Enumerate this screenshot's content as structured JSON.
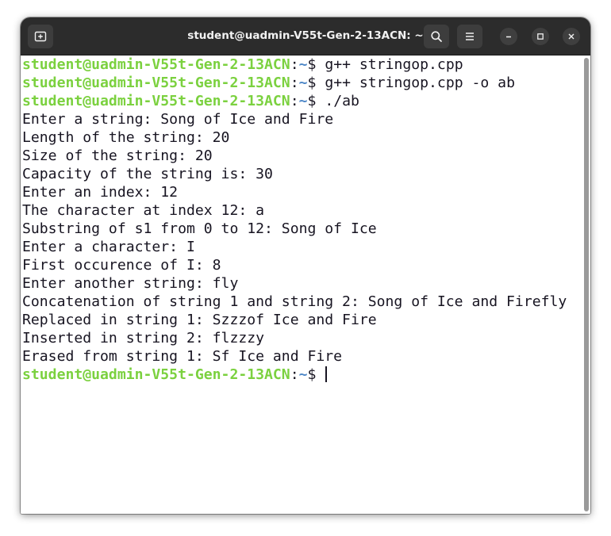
{
  "window": {
    "title": "student@uadmin-V55t-Gen-2-13ACN: ~",
    "new_tab_icon": "new-tab-icon",
    "search_icon": "search-icon",
    "menu_icon": "hamburger-menu-icon",
    "minimize_icon": "minimize-icon",
    "maximize_icon": "maximize-icon",
    "close_icon": "close-icon"
  },
  "colors": {
    "prompt_user": "#7bd13f",
    "prompt_path": "#4f88c8",
    "text": "#171421",
    "titlebar": "#2c2c2c"
  },
  "prompt": {
    "user_host": "student@uadmin-V55t-Gen-2-13ACN",
    "sep": ":",
    "path": "~",
    "symbol": "$ "
  },
  "terminal": {
    "lines": [
      {
        "type": "cmd",
        "text": "g++ stringop.cpp"
      },
      {
        "type": "cmd",
        "text": "g++ stringop.cpp -o ab"
      },
      {
        "type": "cmd",
        "text": "./ab"
      },
      {
        "type": "out",
        "text": "Enter a string: Song of Ice and Fire"
      },
      {
        "type": "out",
        "text": "Length of the string: 20"
      },
      {
        "type": "out",
        "text": "Size of the string: 20"
      },
      {
        "type": "out",
        "text": "Capacity of the string is: 30"
      },
      {
        "type": "out",
        "text": "Enter an index: 12"
      },
      {
        "type": "out",
        "text": "The character at index 12: a"
      },
      {
        "type": "out",
        "text": "Substring of s1 from 0 to 12: Song of Ice"
      },
      {
        "type": "out",
        "text": "Enter a character: I"
      },
      {
        "type": "out",
        "text": "First occurence of I: 8"
      },
      {
        "type": "out",
        "text": "Enter another string: fly"
      },
      {
        "type": "out",
        "text": "Concatenation of string 1 and string 2: Song of Ice and Firefly"
      },
      {
        "type": "out",
        "text": "Replaced in string 1: Szzzof Ice and Fire"
      },
      {
        "type": "out",
        "text": "Inserted in string 2: flzzzy"
      },
      {
        "type": "out",
        "text": "Erased from string 1: Sf Ice and Fire"
      },
      {
        "type": "cmd",
        "text": "",
        "cursor": true
      }
    ]
  }
}
